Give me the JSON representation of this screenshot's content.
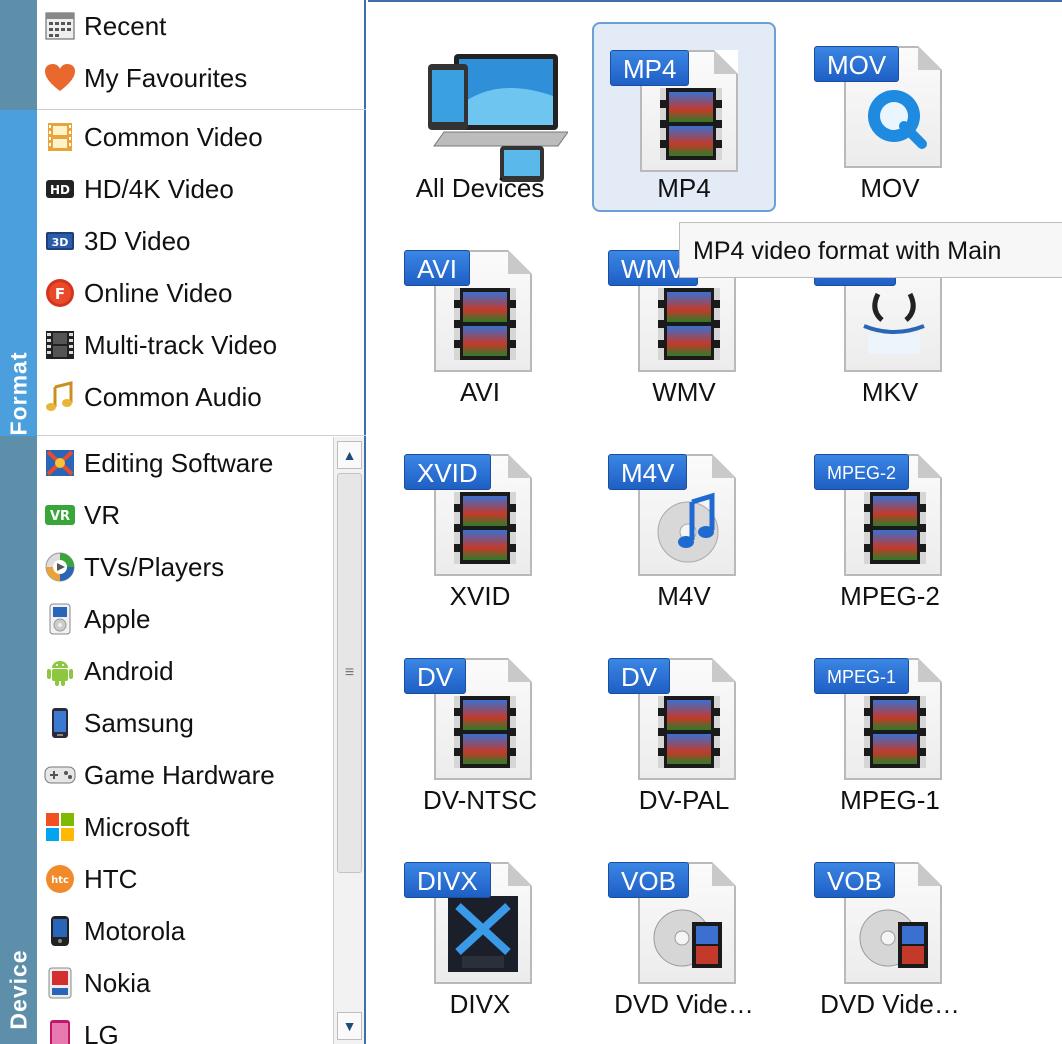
{
  "tabs": {
    "format": "Format",
    "device": "Device"
  },
  "recent_items": [
    {
      "label": "Recent",
      "icon": "calendar-icon"
    },
    {
      "label": "My Favourites",
      "icon": "heart-icon"
    }
  ],
  "format_items": [
    {
      "label": "Common Video",
      "icon": "film-icon"
    },
    {
      "label": "HD/4K Video",
      "icon": "hd-icon"
    },
    {
      "label": "3D Video",
      "icon": "3d-icon"
    },
    {
      "label": "Online Video",
      "icon": "online-icon"
    },
    {
      "label": "Multi-track Video",
      "icon": "filmstrip-icon"
    },
    {
      "label": "Common Audio",
      "icon": "music-note-icon"
    }
  ],
  "device_items": [
    {
      "label": "Editing Software",
      "icon": "editing-icon"
    },
    {
      "label": "VR",
      "icon": "vr-icon"
    },
    {
      "label": "TVs/Players",
      "icon": "tv-icon"
    },
    {
      "label": "Apple",
      "icon": "ipod-icon"
    },
    {
      "label": "Android",
      "icon": "android-icon"
    },
    {
      "label": "Samsung",
      "icon": "samsung-phone-icon"
    },
    {
      "label": "Game Hardware",
      "icon": "gamepad-icon"
    },
    {
      "label": "Microsoft",
      "icon": "windows-icon"
    },
    {
      "label": "HTC",
      "icon": "htc-icon"
    },
    {
      "label": "Motorola",
      "icon": "motorola-icon"
    },
    {
      "label": "Nokia",
      "icon": "nokia-icon"
    },
    {
      "label": "LG",
      "icon": "lg-icon"
    }
  ],
  "grid": [
    {
      "label": "All Devices",
      "badge": "",
      "icon": "devices-icon"
    },
    {
      "label": "MP4",
      "badge": "MP4",
      "selected": true
    },
    {
      "label": "MOV",
      "badge": "MOV",
      "icon": "quicktime-icon"
    },
    {
      "label": "AVI",
      "badge": "AVI"
    },
    {
      "label": "WMV",
      "badge": "WMV"
    },
    {
      "label": "MKV",
      "badge": "MKV",
      "icon": "matroska-icon"
    },
    {
      "label": "XVID",
      "badge": "XVID"
    },
    {
      "label": "M4V",
      "badge": "M4V",
      "icon": "itunes-icon"
    },
    {
      "label": "MPEG-2",
      "badge": "MPEG-2"
    },
    {
      "label": "DV-NTSC",
      "badge": "DV"
    },
    {
      "label": "DV-PAL",
      "badge": "DV"
    },
    {
      "label": "MPEG-1",
      "badge": "MPEG-1"
    },
    {
      "label": "DIVX",
      "badge": "DIVX",
      "icon": "divx-icon"
    },
    {
      "label": "DVD Vide…",
      "badge": "VOB",
      "icon": "dvd-icon"
    },
    {
      "label": "DVD Vide…",
      "badge": "VOB",
      "icon": "dvd-icon"
    }
  ],
  "tooltip": "MP4 video format with Main"
}
